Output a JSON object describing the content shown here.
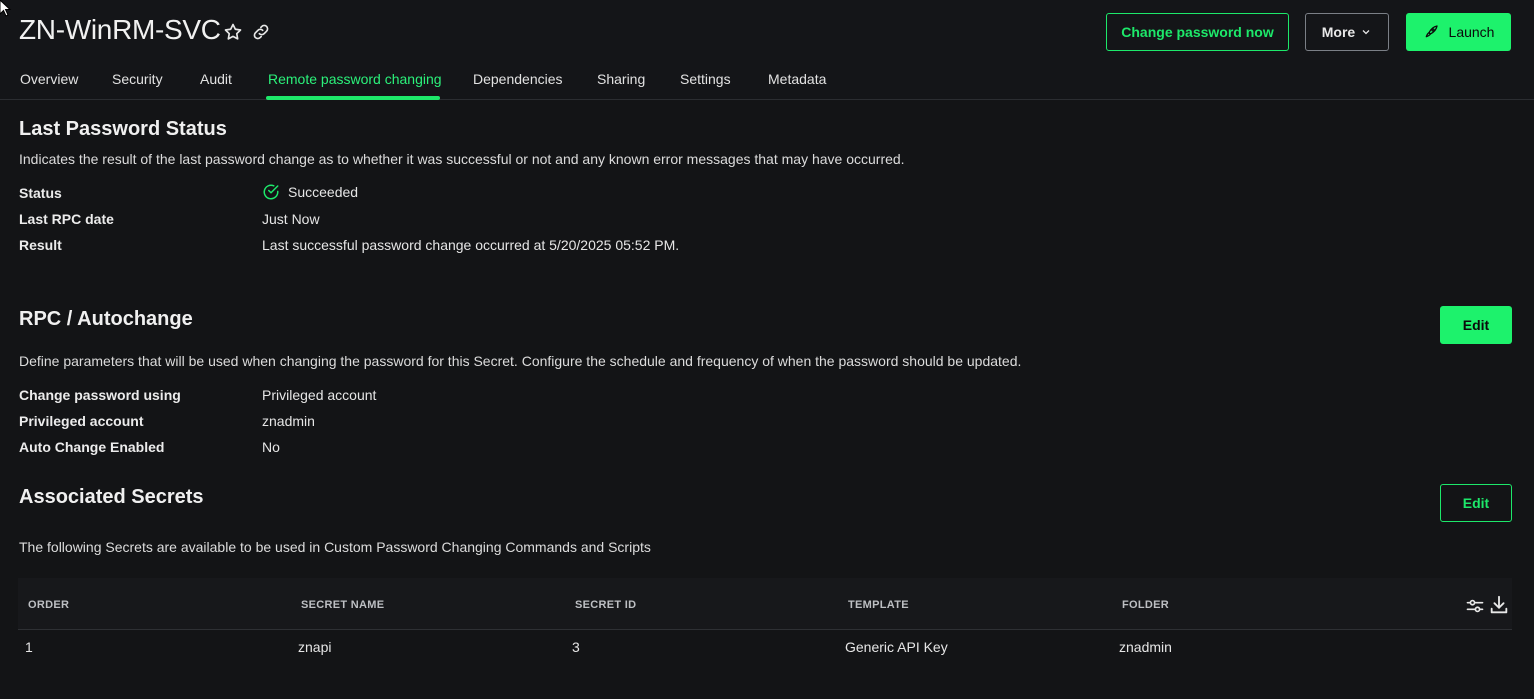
{
  "header": {
    "title": "ZN-WinRM-SVC",
    "star_icon": "star-icon",
    "link_icon": "link-icon",
    "change_password_label": "Change password now",
    "more_label": "More",
    "launch_label": "Launch",
    "launch_icon": "rocket-icon"
  },
  "tabs": [
    {
      "label": "Overview"
    },
    {
      "label": "Security"
    },
    {
      "label": "Audit"
    },
    {
      "label": "Remote password changing",
      "active": true
    },
    {
      "label": "Dependencies"
    },
    {
      "label": "Sharing"
    },
    {
      "label": "Settings"
    },
    {
      "label": "Metadata"
    }
  ],
  "last_status": {
    "heading": "Last Password Status",
    "description": "Indicates the result of the last password change as to whether it was successful or not and any known error messages that may have occurred.",
    "status_label": "Status",
    "status_value": "Succeeded",
    "status_icon": "check-circle-icon",
    "rpc_date_label": "Last RPC date",
    "rpc_date_value": "Just Now",
    "result_label": "Result",
    "result_value": "Last successful password change occurred at 5/20/2025 05:52 PM."
  },
  "rpc": {
    "heading": "RPC / Autochange",
    "edit_label": "Edit",
    "description": "Define parameters that will be used when changing the password for this Secret. Configure the schedule and frequency of when the password should be updated.",
    "change_using_label": "Change password using",
    "change_using_value": "Privileged account",
    "priv_account_label": "Privileged account",
    "priv_account_value": "znadmin",
    "auto_change_label": "Auto Change Enabled",
    "auto_change_value": "No"
  },
  "associated": {
    "heading": "Associated Secrets",
    "edit_label": "Edit",
    "description": "The following Secrets are available to be used in Custom Password Changing Commands and Scripts",
    "columns": [
      "ORDER",
      "SECRET NAME",
      "SECRET ID",
      "TEMPLATE",
      "FOLDER"
    ],
    "rows": [
      {
        "order": "1",
        "secret_name": "znapi",
        "secret_id": "3",
        "template": "Generic API Key",
        "folder": "znadmin"
      }
    ],
    "filter_icon": "sliders-icon",
    "download_icon": "download-icon"
  },
  "colors": {
    "accent": "#1df26c",
    "background": "#131416"
  }
}
